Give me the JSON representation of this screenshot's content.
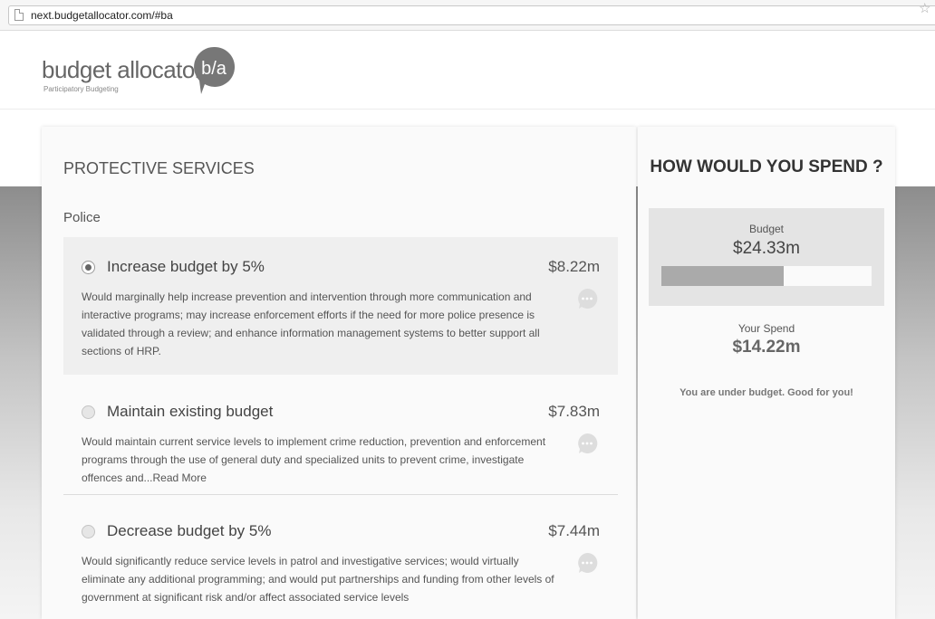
{
  "browser": {
    "url": "next.budgetallocator.com/#ba"
  },
  "brand": {
    "name": "budget allocator",
    "tagline": "Participatory Budgeting",
    "mark": "b/a"
  },
  "category": {
    "title": "PROTECTIVE SERVICES",
    "subtitle": "Police"
  },
  "options": [
    {
      "label": "Increase budget by 5%",
      "price": "$8.22m",
      "selected": true,
      "description": "Would marginally help increase prevention and intervention through more communication and interactive programs; may increase enforcement efforts if the need for more police presence is validated through a review; and enhance information management systems to better support all sections of HRP."
    },
    {
      "label": "Maintain existing budget",
      "price": "$7.83m",
      "selected": false,
      "description": "Would maintain current service levels to implement crime reduction, prevention and enforcement programs through the use of general duty and specialized units to prevent crime, investigate offences and...Read More"
    },
    {
      "label": "Decrease budget by 5%",
      "price": "$7.44m",
      "selected": false,
      "description": "Would significantly reduce service levels in patrol and investigative services; would virtually eliminate any additional programming; and would put partnerships and funding from other levels of government at significant risk and/or affect associated service levels"
    }
  ],
  "summary": {
    "heading": "HOW WOULD YOU SPEND ?",
    "budget_label": "Budget",
    "budget_value": "$24.33m",
    "spend_label": "Your Spend",
    "spend_value": "$14.22m",
    "spend_fraction": 0.584,
    "message": "You are under budget. Good for you!"
  },
  "colors": {
    "selected_bg": "#efefef",
    "bar_fill": "#aaaaaa",
    "bubble": "#777777"
  },
  "icons": {
    "page": "page-icon",
    "star": "star-icon",
    "comment": "comment-icon",
    "radio": "radio-icon"
  }
}
